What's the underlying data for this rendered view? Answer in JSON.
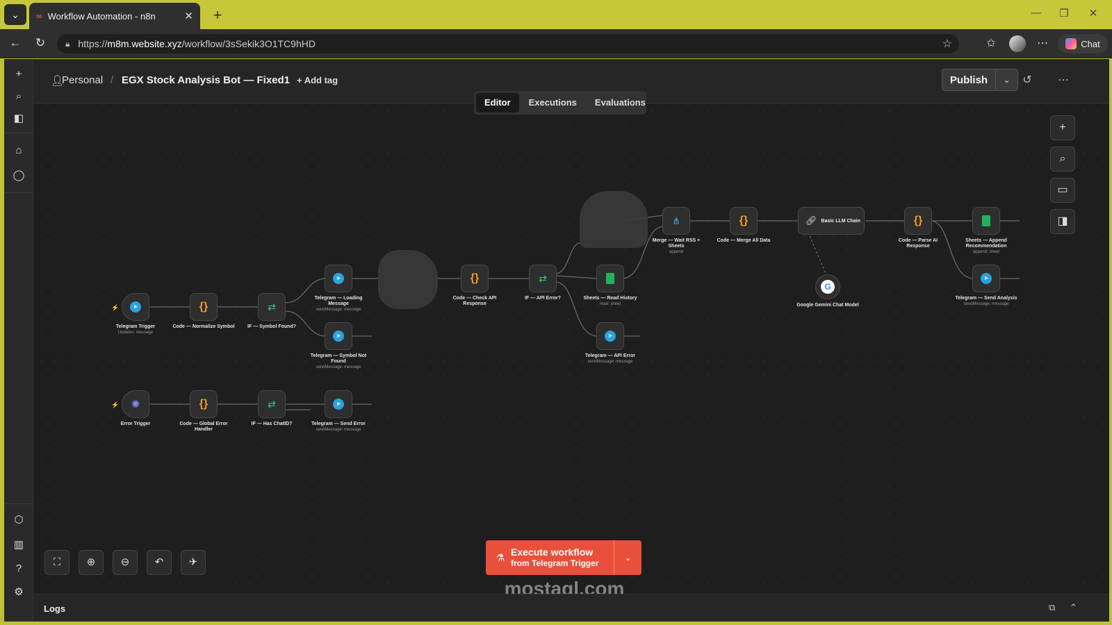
{
  "browser": {
    "tab_title": "Workflow Automation - n8n",
    "url_prefix": "https://",
    "url_host": "m8m.website.xyz",
    "url_path": "/workflow/3sSekik3O1TC9hHD",
    "chat_label": "Chat"
  },
  "header": {
    "project": "Personal",
    "workflow_name": "EGX Stock Analysis Bot — Fixed1",
    "add_tag": "+ Add tag",
    "publish": "Publish"
  },
  "tabs": {
    "editor": "Editor",
    "executions": "Executions",
    "evaluations": "Evaluations"
  },
  "nodes": {
    "telegram_trigger": {
      "name": "Telegram Trigger",
      "sub": "Updates: message"
    },
    "code_normalize": {
      "name": "Code — Normalize Symbol",
      "sub": ""
    },
    "if_symbol_found": {
      "name": "IF — Symbol Found?",
      "sub": ""
    },
    "tg_loading": {
      "name": "Telegram — Loading Message",
      "sub": "sendMessage: message"
    },
    "tg_not_found": {
      "name": "Telegram — Symbol Not Found",
      "sub": "sendMessage: message"
    },
    "code_check_api": {
      "name": "Code — Check API Response",
      "sub": ""
    },
    "if_api_error": {
      "name": "IF — API Error?",
      "sub": ""
    },
    "sheets_read": {
      "name": "Sheets — Read History",
      "sub": "read: sheet"
    },
    "tg_api_error": {
      "name": "Telegram — API Error",
      "sub": "sendMessage: message"
    },
    "merge": {
      "name": "Merge — Wait RSS + Sheets",
      "sub": "append"
    },
    "code_merge": {
      "name": "Code — Merge All Data",
      "sub": ""
    },
    "llm_chain": {
      "name": "Basic LLM Chain",
      "sub": ""
    },
    "gemini": {
      "name": "Google Gemini Chat Model",
      "sub": ""
    },
    "code_parse": {
      "name": "Code — Parse AI Response",
      "sub": ""
    },
    "sheets_append": {
      "name": "Sheets — Append Recommendation",
      "sub": "append: sheet"
    },
    "tg_send_analysis": {
      "name": "Telegram — Send Analysis",
      "sub": "sendMessage: message"
    },
    "error_trigger": {
      "name": "Error Trigger",
      "sub": ""
    },
    "code_global_error": {
      "name": "Code — Global Error Handler",
      "sub": ""
    },
    "if_has_chatid": {
      "name": "IF — Has ChatID?",
      "sub": ""
    },
    "tg_send_error": {
      "name": "Telegram — Send Error",
      "sub": "sendMessage: message"
    }
  },
  "execute": {
    "line1": "Execute workflow",
    "line2": "from Telegram Trigger"
  },
  "watermark": "mostaql.com",
  "logs_label": "Logs"
}
